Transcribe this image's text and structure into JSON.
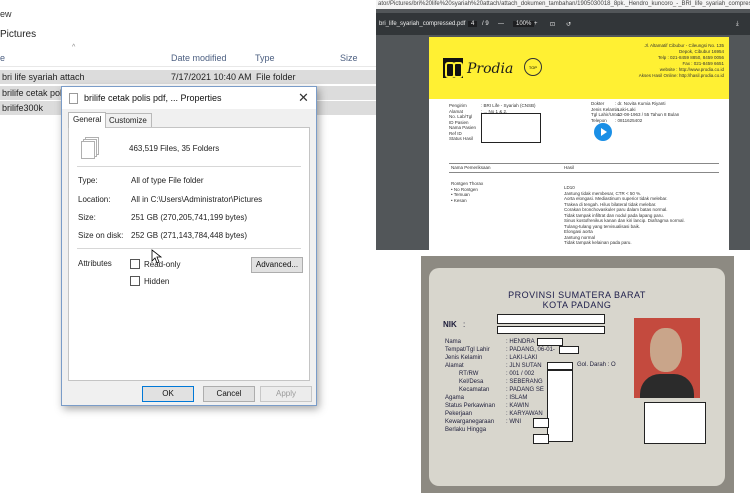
{
  "explorer": {
    "menu_label": "ew",
    "path_label": "Pictures",
    "columns": {
      "name": "e",
      "date": "Date modified",
      "type": "Type",
      "size": "Size"
    },
    "rows": [
      {
        "name": "bri life syariah attach",
        "date": "7/17/2021 10:40 AM",
        "type": "File folder",
        "selected": true
      },
      {
        "name": "brilife cetak polis",
        "date": "",
        "type": "",
        "selected": true
      },
      {
        "name": "brilife300k",
        "date": "",
        "type": "",
        "selected": true
      }
    ]
  },
  "dialog": {
    "title": "brilife cetak polis pdf, ... Properties",
    "close_glyph": "✕",
    "tabs": [
      "General",
      "Customize"
    ],
    "summary": "463,519 Files, 35 Folders",
    "type_label": "Type:",
    "type_value": "All of type File folder",
    "location_label": "Location:",
    "location_value": "All in C:\\Users\\Administrator\\Pictures",
    "size_label": "Size:",
    "size_value": "251 GB (270,205,741,199 bytes)",
    "disk_label": "Size on disk:",
    "disk_value": "252 GB (271,143,784,448 bytes)",
    "attributes_label": "Attributes",
    "readonly_label": "Read-only",
    "hidden_label": "Hidden",
    "advanced_label": "Advanced...",
    "ok_label": "OK",
    "cancel_label": "Cancel",
    "apply_label": "Apply"
  },
  "pdf": {
    "url": "ator/Pictures/bri%20life%20syariah%20attach/attach_dokumen_tambahan/1905030018_8pk._Hendro_kuncoro_-_BRI_life_syariah_compressed.pdf",
    "filename": "bri_life_syariah_compressed.pdf",
    "page_current": "4",
    "page_total": "/ 9",
    "zoom": "100%",
    "brand": "Prodia",
    "address_lines": [
      "Jl. Altamatif Cibubur - Cileungsi No. 135",
      "Depok, Cibubur 16954",
      "Telp : 021-8459 8850, 8459 0056",
      "Fax : 021-8459 6651",
      "website : http://www.prodia.co.id",
      "Akses Hasil Online: http://hasil.prodia.co.id"
    ],
    "fields_left": [
      "Pengirim",
      "Alamat",
      "",
      "No. Lab/Tgl",
      "ID Pasien",
      "Nama Pasien",
      "Ref ID",
      "",
      "Status Hasil"
    ],
    "sender": ": BRI Life - Syariah (CNSB)",
    "sender_addr": ": ... No 1 & 2,",
    "fields_right": [
      "Dokter",
      "",
      "",
      "Jenis Kelamin",
      "Tgl Lahir/Umur",
      "Telepon"
    ],
    "values_right": [
      ": dr. Novita Kumia Riyanti",
      "",
      "",
      ": Laki-Laki",
      ": 12-08-1963 / 55 Tahun 8 Bulan",
      ": 0811625402"
    ],
    "table_head_left": "Nama Pemeriksaan",
    "table_head_right": "Hasil",
    "exam_rows": [
      "Rontgen Thorax",
      "   • No Rontgen",
      "   • Temuan",
      "",
      "",
      "",
      "",
      "",
      "   • Kesan"
    ],
    "result_lines": [
      "LD10",
      "Jantung tidak membesar, CTR < 50 %.",
      "Aorta elongasi. Mediastinum superior tidak melebar.",
      "Trakea di tengah. Hilus bilateral tidak melebar.",
      "Corakan bronchovaskuler paru dalam batas normal.",
      "Tidak tampak infiltrat dan nodul pada lapang paru.",
      "Sinus kostofrenikus kanan dan kiri lancip. Diafragma normal.",
      "Tulang-tulang yang tervisualisasi baik.",
      "",
      "Elongasi aorta",
      "Jantung normal",
      "Tidak tampak kelainan pada paru."
    ]
  },
  "idcard": {
    "province": "PROVINSI SUMATERA BARAT",
    "city": "KOTA PADANG",
    "nik_label": "NIK",
    "labels": [
      "Nama",
      "Tempat/Tgl Lahir",
      "Jenis Kelamin",
      "Alamat",
      "RT/RW",
      "Kel/Desa",
      "Kecamatan",
      "Agama",
      "Status Perkawinan",
      "Pekerjaan",
      "Kewarganegaraan",
      "Berlaku Hingga"
    ],
    "values": [
      ": HENDRA",
      ": PADANG, 06-01-",
      ": LAKI-LAKI",
      ": JLN SUTAN",
      ": 001 / 002",
      ": SEBERANG",
      ": PADANG SE",
      ": ISLAM",
      ": KAWIN",
      ": KARYAWAN",
      ": WNI",
      ""
    ],
    "blood_label": "Gol. Darah : O"
  }
}
